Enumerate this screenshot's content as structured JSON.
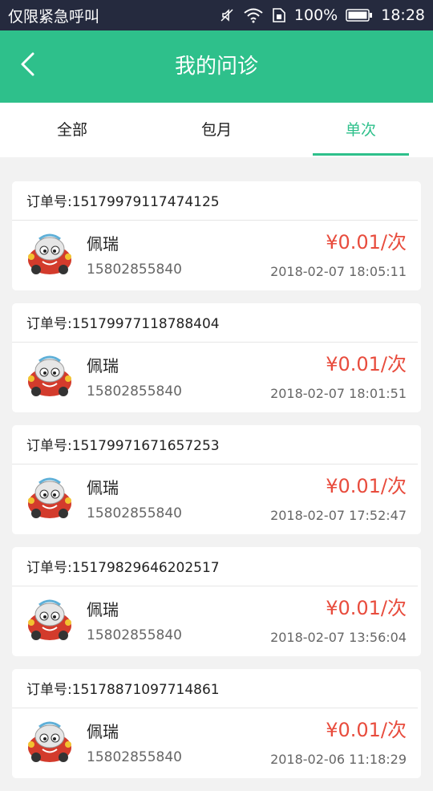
{
  "status_bar": {
    "carrier": "仅限紧急呼叫",
    "battery": "100%",
    "time": "18:28",
    "icons": [
      "mute-icon",
      "wifi-icon",
      "sim-icon",
      "battery-icon"
    ]
  },
  "header": {
    "title": "我的问诊",
    "back_icon": "chevron-left-icon",
    "color": "#2ec08b"
  },
  "tabs": [
    {
      "label": "全部",
      "active": false
    },
    {
      "label": "包月",
      "active": false
    },
    {
      "label": "单次",
      "active": true
    }
  ],
  "orders": [
    {
      "order_label": "订单号:15179979117474125",
      "name": "佩瑞",
      "phone": "15802855840",
      "price": "¥0.01/次",
      "datetime": "2018-02-07 18:05:11"
    },
    {
      "order_label": "订单号:15179977118788404",
      "name": "佩瑞",
      "phone": "15802855840",
      "price": "¥0.01/次",
      "datetime": "2018-02-07 18:01:51"
    },
    {
      "order_label": "订单号:15179971671657253",
      "name": "佩瑞",
      "phone": "15802855840",
      "price": "¥0.01/次",
      "datetime": "2018-02-07 17:52:47"
    },
    {
      "order_label": "订单号:15179829646202517",
      "name": "佩瑞",
      "phone": "15802855840",
      "price": "¥0.01/次",
      "datetime": "2018-02-07 13:56:04"
    },
    {
      "order_label": "订单号:15178871097714861",
      "name": "佩瑞",
      "phone": "15802855840",
      "price": "¥0.01/次",
      "datetime": "2018-02-06 11:18:29"
    }
  ],
  "colors": {
    "accent": "#2ec08b",
    "price": "#e84c3d",
    "status_bar": "#252a3e"
  }
}
